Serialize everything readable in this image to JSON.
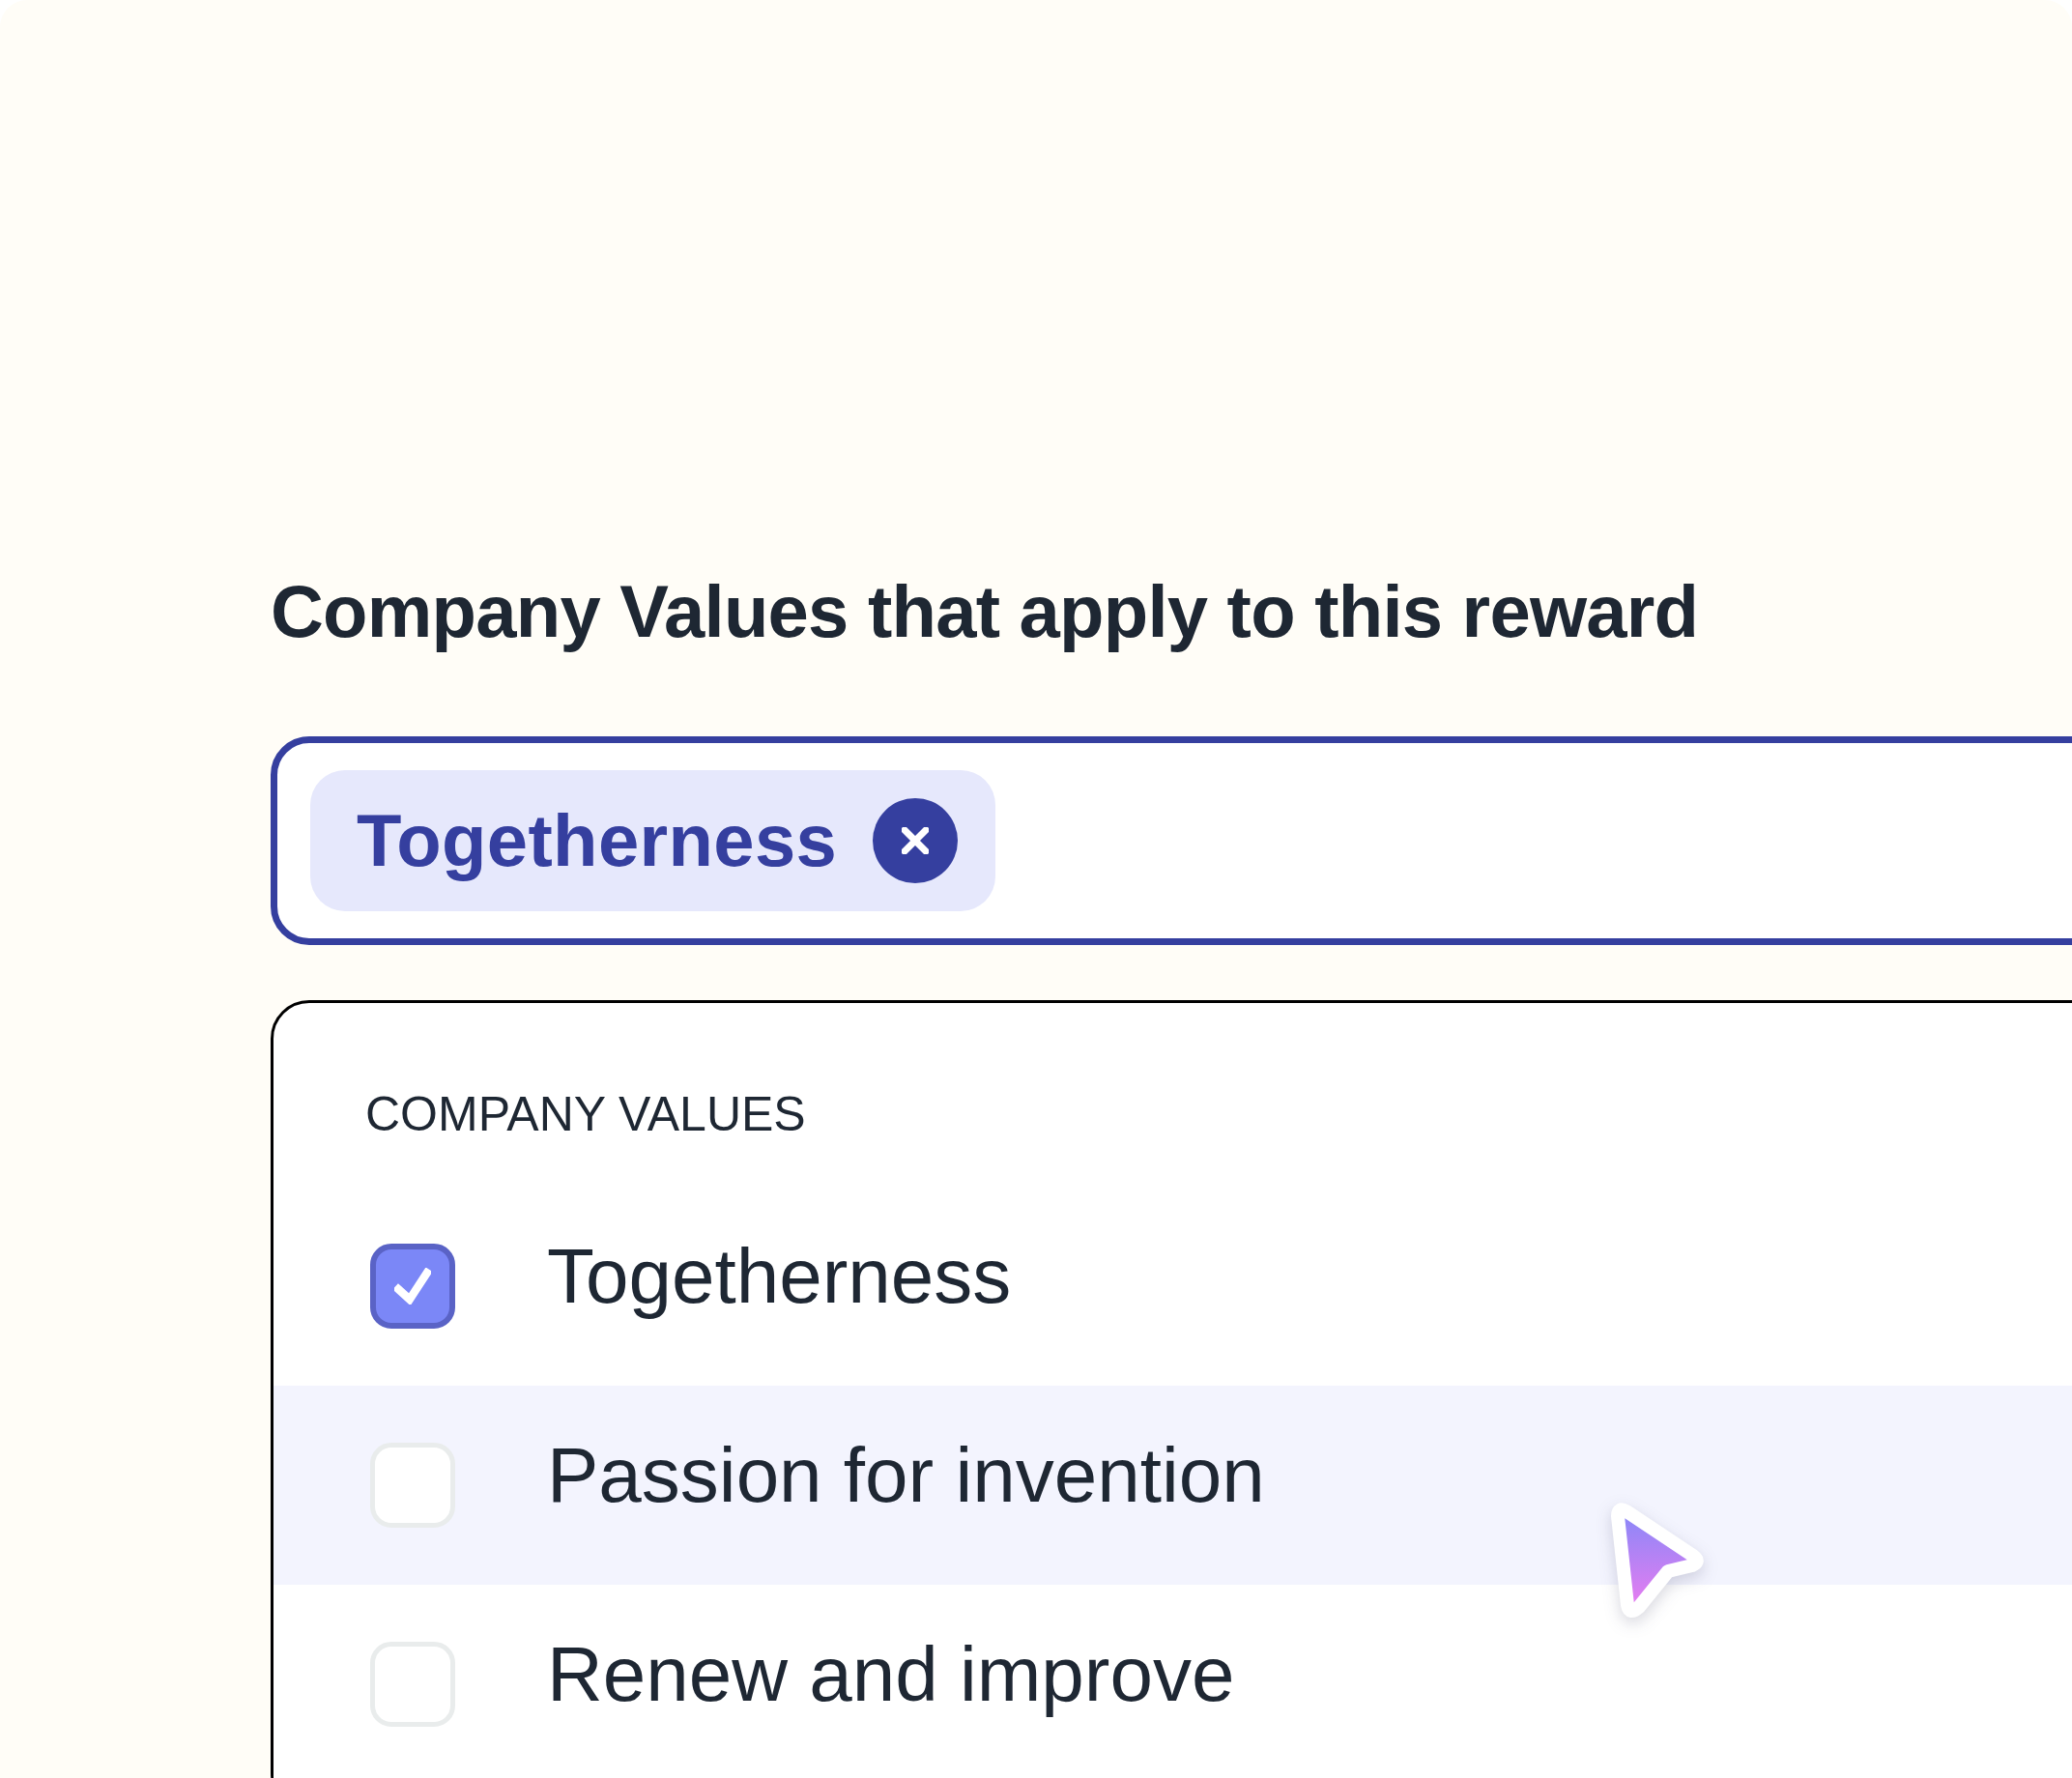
{
  "heading": "Company Values that apply to this reward",
  "tag_field": {
    "chips": [
      {
        "label": "Togetherness"
      }
    ]
  },
  "dropdown": {
    "section_label": "COMPANY VALUES",
    "options": [
      {
        "label": "Togetherness",
        "checked": true,
        "hovered": false
      },
      {
        "label": "Passion for invention",
        "checked": false,
        "hovered": true
      },
      {
        "label": "Renew and improve",
        "checked": false,
        "hovered": false
      }
    ]
  }
}
